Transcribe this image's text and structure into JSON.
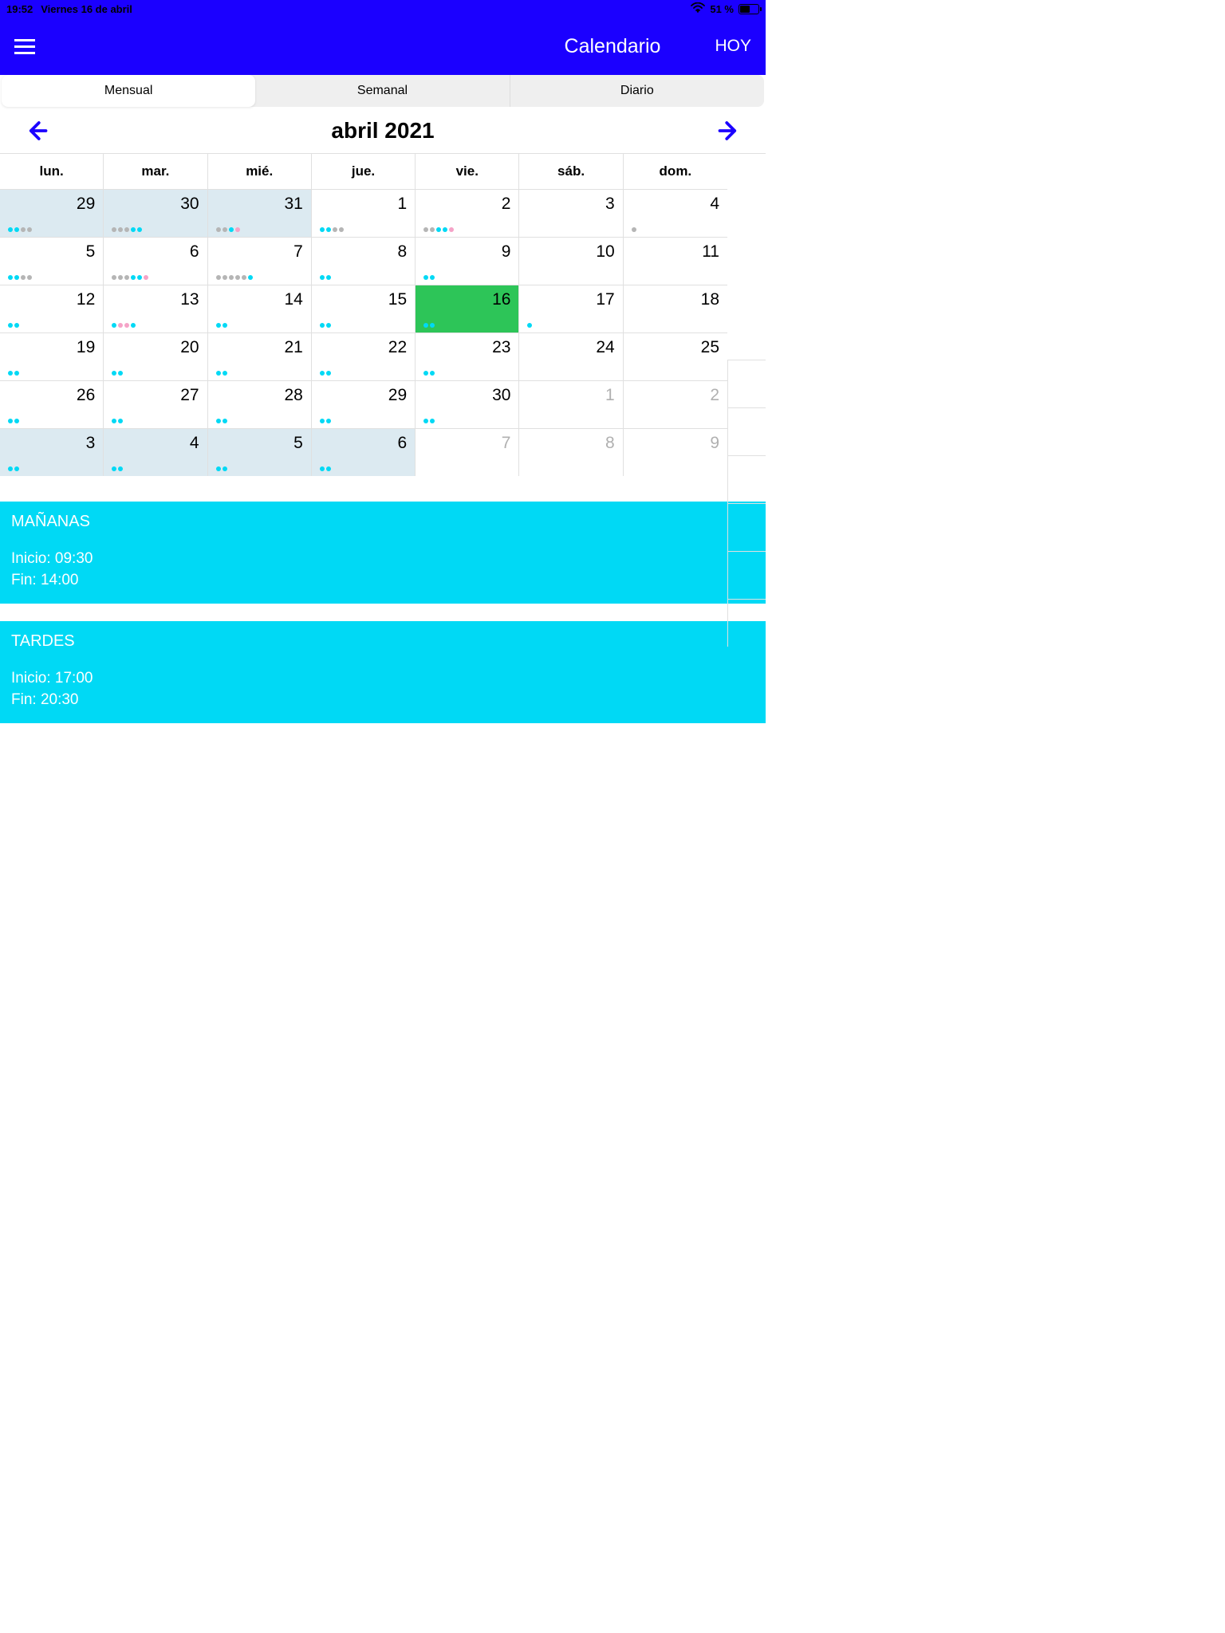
{
  "status": {
    "time": "19:52",
    "date": "Viernes 16 de abril",
    "battery": "51 %"
  },
  "nav": {
    "title": "Calendario",
    "today": "HOY"
  },
  "segmented": {
    "monthly": "Mensual",
    "weekly": "Semanal",
    "daily": "Diario"
  },
  "month": {
    "label": "abril 2021"
  },
  "dayHeaders": [
    "lun.",
    "mar.",
    "mié.",
    "jue.",
    "vie.",
    "sáb.",
    "dom."
  ],
  "weeks": [
    [
      {
        "n": "29",
        "cls": "prev",
        "dots": [
          "c",
          "c",
          "g",
          "g"
        ]
      },
      {
        "n": "30",
        "cls": "prev",
        "dots": [
          "g",
          "g",
          "g",
          "c",
          "c"
        ]
      },
      {
        "n": "31",
        "cls": "prev",
        "dots": [
          "g",
          "g",
          "c",
          "p"
        ]
      },
      {
        "n": "1",
        "cls": "",
        "dots": [
          "c",
          "c",
          "g",
          "g"
        ]
      },
      {
        "n": "2",
        "cls": "",
        "dots": [
          "g",
          "g",
          "c",
          "c",
          "p"
        ]
      },
      {
        "n": "3",
        "cls": "",
        "dots": []
      },
      {
        "n": "4",
        "cls": "",
        "dots": [
          "g"
        ]
      }
    ],
    [
      {
        "n": "5",
        "cls": "",
        "dots": [
          "c",
          "c",
          "g",
          "g"
        ]
      },
      {
        "n": "6",
        "cls": "",
        "dots": [
          "g",
          "g",
          "g",
          "c",
          "c",
          "p"
        ]
      },
      {
        "n": "7",
        "cls": "",
        "dots": [
          "g",
          "g",
          "g",
          "g",
          "g",
          "c"
        ]
      },
      {
        "n": "8",
        "cls": "",
        "dots": [
          "c",
          "c"
        ]
      },
      {
        "n": "9",
        "cls": "",
        "dots": [
          "c",
          "c"
        ]
      },
      {
        "n": "10",
        "cls": "",
        "dots": []
      },
      {
        "n": "11",
        "cls": "",
        "dots": []
      }
    ],
    [
      {
        "n": "12",
        "cls": "",
        "dots": [
          "c",
          "c"
        ]
      },
      {
        "n": "13",
        "cls": "",
        "dots": [
          "c",
          "p",
          "p",
          "c"
        ]
      },
      {
        "n": "14",
        "cls": "",
        "dots": [
          "c",
          "c"
        ]
      },
      {
        "n": "15",
        "cls": "",
        "dots": [
          "c",
          "c"
        ]
      },
      {
        "n": "16",
        "cls": "today",
        "dots": [
          "c",
          "c"
        ]
      },
      {
        "n": "17",
        "cls": "",
        "dots": [
          "c"
        ]
      },
      {
        "n": "18",
        "cls": "",
        "dots": []
      }
    ],
    [
      {
        "n": "19",
        "cls": "",
        "dots": [
          "c",
          "c"
        ]
      },
      {
        "n": "20",
        "cls": "",
        "dots": [
          "c",
          "c"
        ]
      },
      {
        "n": "21",
        "cls": "",
        "dots": [
          "c",
          "c"
        ]
      },
      {
        "n": "22",
        "cls": "",
        "dots": [
          "c",
          "c"
        ]
      },
      {
        "n": "23",
        "cls": "",
        "dots": [
          "c",
          "c"
        ]
      },
      {
        "n": "24",
        "cls": "",
        "dots": []
      },
      {
        "n": "25",
        "cls": "",
        "dots": []
      }
    ],
    [
      {
        "n": "26",
        "cls": "",
        "dots": [
          "c",
          "c"
        ]
      },
      {
        "n": "27",
        "cls": "",
        "dots": [
          "c",
          "c"
        ]
      },
      {
        "n": "28",
        "cls": "",
        "dots": [
          "c",
          "c"
        ]
      },
      {
        "n": "29",
        "cls": "",
        "dots": [
          "c",
          "c"
        ]
      },
      {
        "n": "30",
        "cls": "",
        "dots": [
          "c",
          "c"
        ]
      },
      {
        "n": "1",
        "cls": "future-gray",
        "dots": []
      },
      {
        "n": "2",
        "cls": "future-gray",
        "dots": []
      }
    ],
    [
      {
        "n": "3",
        "cls": "next-month-adj",
        "dots": [
          "c",
          "c"
        ]
      },
      {
        "n": "4",
        "cls": "next-month-adj",
        "dots": [
          "c",
          "c"
        ]
      },
      {
        "n": "5",
        "cls": "next-month-adj",
        "dots": [
          "c",
          "c"
        ]
      },
      {
        "n": "6",
        "cls": "next-month-adj",
        "dots": [
          "c",
          "c"
        ]
      },
      {
        "n": "7",
        "cls": "future-gray",
        "dots": []
      },
      {
        "n": "8",
        "cls": "future-gray",
        "dots": []
      },
      {
        "n": "9",
        "cls": "future-gray",
        "dots": []
      }
    ]
  ],
  "events": [
    {
      "title": "MAÑANAS",
      "startLabel": "Inicio: 09:30",
      "endLabel": "Fin: 14:00"
    },
    {
      "title": "TARDES",
      "startLabel": "Inicio: 17:00",
      "endLabel": "Fin: 20:30"
    }
  ]
}
